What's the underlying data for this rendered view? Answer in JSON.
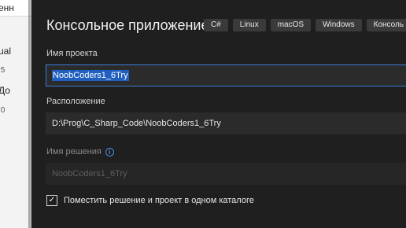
{
  "background_window": {
    "fragments": [
      "енн",
      "ual",
      ".5",
      "До",
      ".0"
    ]
  },
  "dialog": {
    "title": "Консольное приложение",
    "tags": [
      "C#",
      "Linux",
      "macOS",
      "Windows",
      "Консоль"
    ],
    "project_name": {
      "label": "Имя проекта",
      "value": "NoobCoders1_6Try"
    },
    "location": {
      "label": "Расположение",
      "value": "D:\\Prog\\C_Sharp_Code\\NoobCoders1_6Try"
    },
    "solution_name": {
      "label": "Имя решения",
      "value": "NoobCoders1_6Try",
      "info_icon": "info-icon"
    },
    "same_dir_checkbox": {
      "checked": true,
      "label": "Поместить решение и проект в одном каталоге"
    }
  },
  "colors": {
    "dialog_bg": "#1f1f1f",
    "field_bg": "#2b2b2b",
    "accent": "#3c7ad6",
    "selection": "#1f5fbf"
  }
}
